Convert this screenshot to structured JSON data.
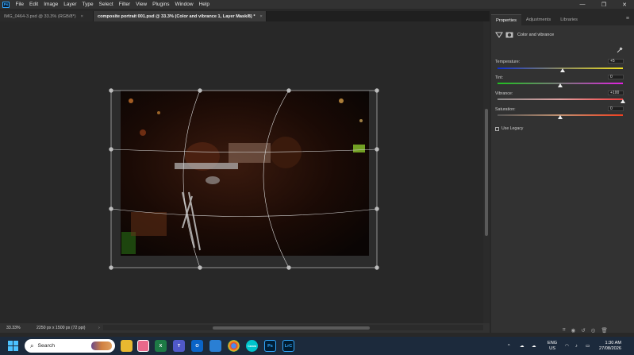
{
  "app": {
    "logo": "Ps",
    "menu": [
      "File",
      "Edit",
      "Image",
      "Layer",
      "Type",
      "Select",
      "Filter",
      "View",
      "Plugins",
      "Window",
      "Help"
    ],
    "window_controls": {
      "minimize": "—",
      "restore": "❐",
      "close": "✕"
    }
  },
  "tabs": [
    {
      "label": "IMG_0464-3.psd @ 33.3% (RGB/8*)",
      "close": "×",
      "active": false
    },
    {
      "label": "composite portrait 001.psd @ 33.3% (Color and vibrance 1, Layer Mask/8) *",
      "close": "×",
      "active": true
    }
  ],
  "status": {
    "zoom": "33.33%",
    "doc_info": "2250 px x 1500 px (72 ppi)",
    "arrow": "›",
    "scroll_left": "‹",
    "scroll_right": "›"
  },
  "panel": {
    "tabs": [
      "Properties",
      "Adjustments",
      "Libraries"
    ],
    "menu_icon": "≡",
    "layer_title": "Color and vibrance",
    "sliders": [
      {
        "label": "Temperature:",
        "value": "+5",
        "level": 0.52
      },
      {
        "label": "Tint:",
        "value": "0",
        "level": 0.5
      },
      {
        "label": "Vibrance:",
        "value": "+100",
        "level": 1.0
      },
      {
        "label": "Saturation:",
        "value": "0",
        "level": 0.5
      }
    ],
    "legacy_label": "Use Legacy",
    "bottom_icons": [
      "clip-icon",
      "visibility-eye-icon",
      "reset-icon",
      "toggle-eye-icon",
      "trash-icon"
    ]
  },
  "taskbar": {
    "search_placeholder": "Search",
    "apps": [
      "file-explorer",
      "edge",
      "excel",
      "teams",
      "outlook",
      "photos",
      "chrome",
      "canva",
      "photoshop",
      "lightroom-classic"
    ],
    "app_labels": {
      "canva": "Canva",
      "photoshop": "Ps",
      "lightroom": "LrC"
    },
    "lang": "ENG",
    "region": "US",
    "time": "1:30 AM",
    "date": "27/08/2026",
    "chevron": "^"
  },
  "colors": {
    "accent": "#31a8ff",
    "menu_bg": "#323232",
    "canvas_bg": "#282828",
    "panel_bg": "#323232",
    "taskbar_bg": "#1c2a3c"
  }
}
